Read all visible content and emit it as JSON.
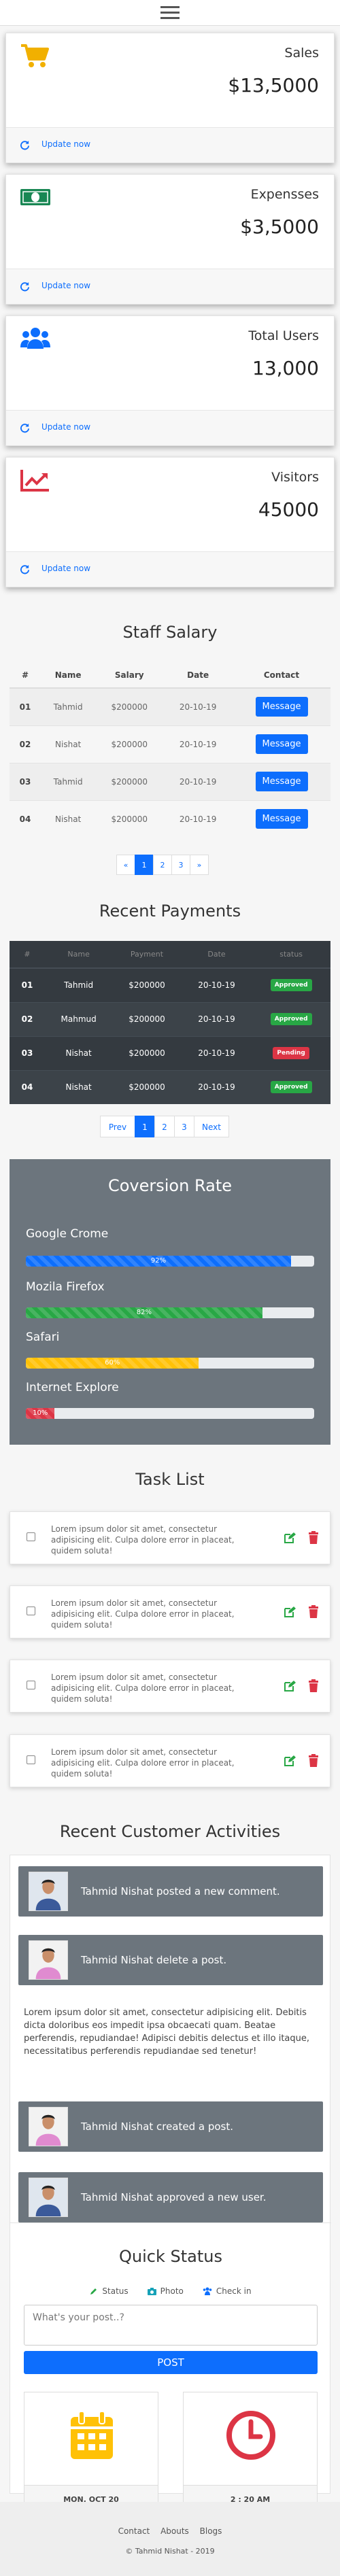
{
  "stats": [
    {
      "title": "Sales",
      "value": "$13,5000",
      "link": "Update now",
      "icon": "cart-icon",
      "color": "#f1b000"
    },
    {
      "title": "Expensses",
      "value": "$3,5000",
      "link": "Update now",
      "icon": "money-icon",
      "color": "#198754"
    },
    {
      "title": "Total Users",
      "value": "13,000",
      "link": "Update now",
      "icon": "users-icon",
      "color": "#0d6efd"
    },
    {
      "title": "Visitors",
      "value": "45000",
      "link": "Update now",
      "icon": "chart-line-icon",
      "color": "#dc3545"
    }
  ],
  "salary": {
    "title": "Staff Salary",
    "headers": [
      "#",
      "Name",
      "Salary",
      "Date",
      "Contact"
    ],
    "rows": [
      {
        "num": "01",
        "name": "Tahmid",
        "salary": "$200000",
        "date": "20-10-19",
        "button": "Message"
      },
      {
        "num": "02",
        "name": "Nishat",
        "salary": "$200000",
        "date": "20-10-19",
        "button": "Message"
      },
      {
        "num": "03",
        "name": "Tahmid",
        "salary": "$200000",
        "date": "20-10-19",
        "button": "Message"
      },
      {
        "num": "04",
        "name": "Nishat",
        "salary": "$200000",
        "date": "20-10-19",
        "button": "Message"
      }
    ],
    "pager": [
      "«",
      "1",
      "2",
      "3",
      "»"
    ]
  },
  "payments": {
    "title": "Recent Payments",
    "headers": [
      "#",
      "Name",
      "Payment",
      "Date",
      "status"
    ],
    "rows": [
      {
        "num": "01",
        "name": "Tahmid",
        "amount": "$200000",
        "date": "20-10-19",
        "status": "Approved",
        "color": "#28a745"
      },
      {
        "num": "02",
        "name": "Mahmud",
        "amount": "$200000",
        "date": "20-10-19",
        "status": "Approved",
        "color": "#28a745"
      },
      {
        "num": "03",
        "name": "Nishat",
        "amount": "$200000",
        "date": "20-10-19",
        "status": "Pending",
        "color": "#dc3545"
      },
      {
        "num": "04",
        "name": "Nishat",
        "amount": "$200000",
        "date": "20-10-19",
        "status": "Approved",
        "color": "#28a745"
      }
    ],
    "pager": [
      "Prev",
      "1",
      "2",
      "3",
      "Next"
    ]
  },
  "conversion": {
    "title": "Coversion Rate",
    "items": [
      {
        "name": "Google Crome",
        "percent": 92,
        "label": "92%",
        "color": "#0d6efd"
      },
      {
        "name": "Mozila Firefox",
        "percent": 82,
        "label": "82%",
        "color": "#28a745"
      },
      {
        "name": "Safari",
        "percent": 60,
        "label": "60%",
        "color": "#ffc107"
      },
      {
        "name": "Internet Explore",
        "percent": 10,
        "label": "10%",
        "color": "#dc3545"
      }
    ]
  },
  "tasks": {
    "title": "Task List",
    "items": [
      {
        "text": "Lorem ipsum dolor sit amet, consectetur adipisicing elit. Culpa dolore error in placeat, quidem soluta!"
      },
      {
        "text": "Lorem ipsum dolor sit amet, consectetur adipisicing elit. Culpa dolore error in placeat, quidem soluta!"
      },
      {
        "text": "Lorem ipsum dolor sit amet, consectetur adipisicing elit. Culpa dolore error in placeat, quidem soluta!"
      },
      {
        "text": "Lorem ipsum dolor sit amet, consectetur adipisicing elit. Culpa dolore error in placeat, quidem soluta!"
      }
    ]
  },
  "activities": {
    "title": "Recent Customer Activities",
    "items": [
      {
        "text": "Tahmid Nishat posted a new comment.",
        "avatar": "male"
      },
      {
        "text": "Tahmid Nishat delete a post.",
        "avatar": "female"
      },
      {
        "text": "Tahmid Nishat created a post.",
        "avatar": "female"
      },
      {
        "text": "Tahmid Nishat approved a new user.",
        "avatar": "male"
      }
    ],
    "paragraph": "Lorem ipsum dolor sit amet, consectetur adipisicing elit. Debitis dicta doloribus eos impedit ipsa obcaecati quam. Beatae perferendis, repudiandae! Adipisci debitis delectus et illo itaque, necessitatibus perferendis repudiandae sed tenetur!"
  },
  "quick_status": {
    "title": "Quick Status",
    "tabs": [
      {
        "label": "Status",
        "icon": "pencil-icon",
        "color": "#28a745"
      },
      {
        "label": "Photo",
        "icon": "camera-icon",
        "color": "#17a2b8"
      },
      {
        "label": "Check in",
        "icon": "users-icon",
        "color": "#0d6efd"
      }
    ],
    "placeholder": "What's your post..?",
    "post_button": "POST",
    "date_card": "MON, OCT 20",
    "time_card": "2 : 20 AM"
  },
  "footer": {
    "links": [
      "Contact",
      "Abouts",
      "Blogs"
    ],
    "copyright": "Tahmid Nishat - 2019"
  }
}
